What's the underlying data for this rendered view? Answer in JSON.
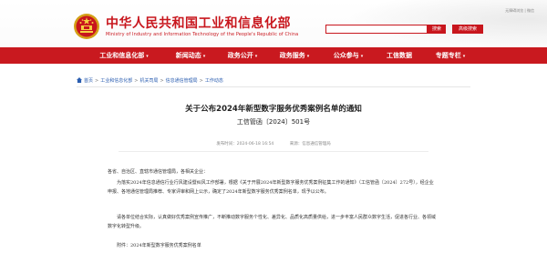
{
  "header": {
    "site_title": "中华人民共和国工业和信息化部",
    "site_subtitle": "Ministry of Industry and Information Technology of the People's Republic of China",
    "top_links": "无障碍浏览 | 微信",
    "search_placeholder": "",
    "search_button": "搜索",
    "advanced_search": "高级搜索",
    "brand_color": "#c8161d"
  },
  "nav": {
    "items": [
      {
        "label": "工业和信息化部"
      },
      {
        "label": "新闻动态"
      },
      {
        "label": "政务公开"
      },
      {
        "label": "政务服务"
      },
      {
        "label": "公众参与"
      },
      {
        "label": "工信数据"
      },
      {
        "label": "专题专栏"
      }
    ],
    "bg_color": "#c9191f"
  },
  "breadcrumb": {
    "items": [
      "首页",
      "工业和信息化部",
      "机关司局",
      "信息通信管理局",
      "工作动态"
    ]
  },
  "article": {
    "title": "关于公布2024年新型数字服务优秀案例名单的通知",
    "doc_number": "工信管函〔2024〕501号",
    "date": "发布时间：2024-06-18 16:54",
    "source": "来源：信息通信管理局",
    "salutation": "各省、自治区、直辖市通信管理局，各相关企业：",
    "body1": "为落实2024年信息通信行业行风建设暨纠风工作部署，根据《关于开展2024年新型数字服务优秀案例征集工作的通知》（工信管函〔2024〕272号），经企业申报、各地通信管理局推荐、专家评审和网上公示，确定了2024年新型数字服务优秀案例名单，现予以公布。",
    "body2": "请各单位结合实际，认真做好优秀案例宣传推广，不断推动数字服务个性化、差异化、品质化高质量供给，进一步丰富人民群众数字生活，促进各行业、各领域数字化转型升级。",
    "attachment": "附件：2024年新型数字服务优秀案例名单"
  }
}
